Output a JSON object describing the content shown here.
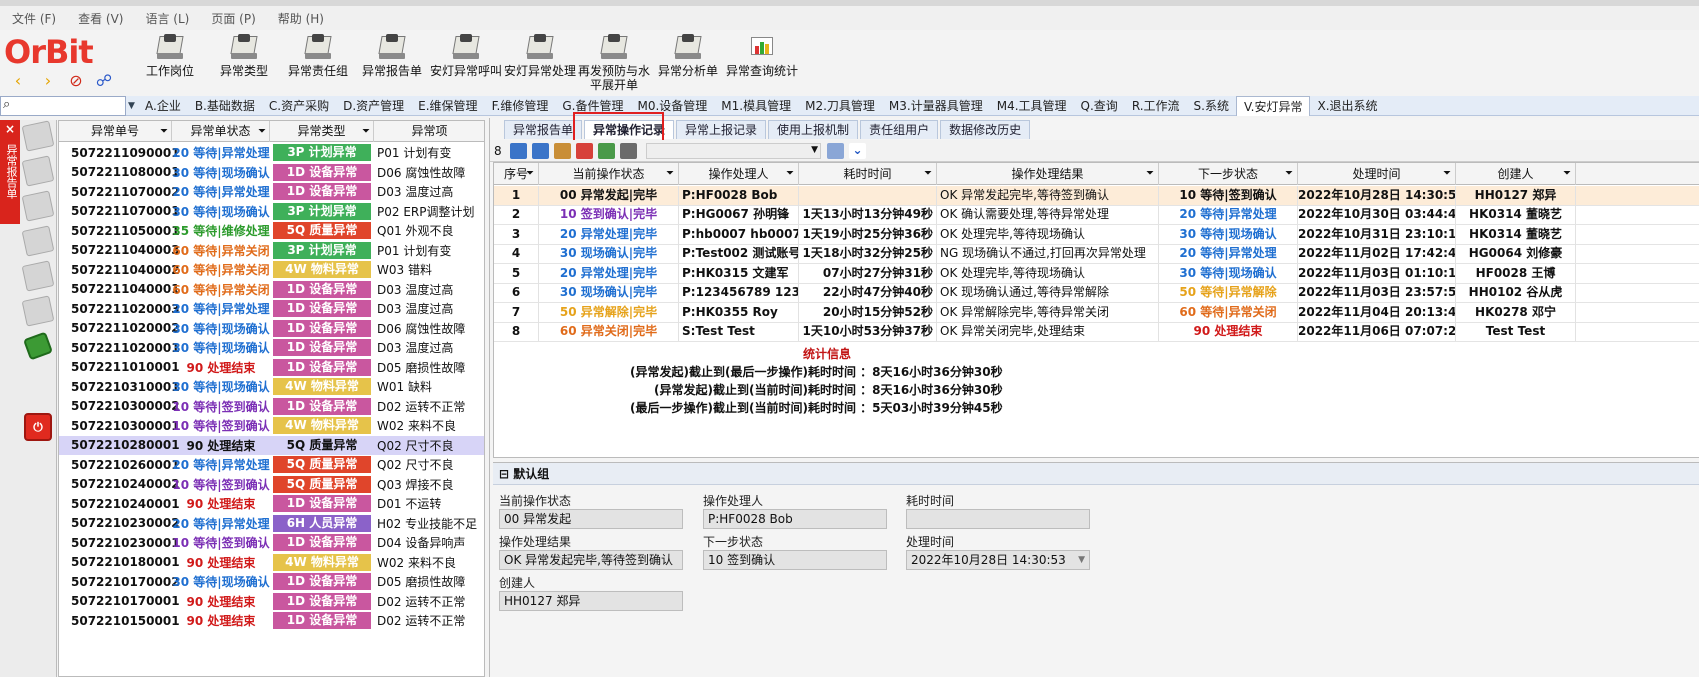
{
  "menu": [
    "文件 (F)",
    "查看 (V)",
    "语言 (L)",
    "页面 (P)",
    "帮助 (H)"
  ],
  "logo": {
    "text": "OrBit"
  },
  "toolbar": [
    "工作岗位",
    "异常类型",
    "异常责任组",
    "异常报告单",
    "安灯异常呼叫",
    "安灯异常处理",
    "再发预防与水平展开单",
    "异常分析单",
    "异常查询统计"
  ],
  "modules": [
    "A.企业",
    "B.基础数据",
    "C.资产采购",
    "D.资产管理",
    "E.维保管理",
    "F.维修管理",
    "G.备件管理",
    "M0.设备管理",
    "M1.模具管理",
    "M2.刀具管理",
    "M3.计量器具管理",
    "M4.工具管理",
    "Q.查询",
    "R.工作流",
    "S.系统",
    "V.安灯异常",
    "X.退出系统"
  ],
  "side_tab": {
    "close": "×",
    "label": "异常报告单"
  },
  "left_list": {
    "headers": [
      "异常单号",
      "异常单状态",
      "异常类型",
      "异常项"
    ],
    "rows": [
      {
        "id": "5072211090001",
        "status": "20 等待|异常处理",
        "sc": "#1f6fd1",
        "type": "3P 计划异常",
        "tc": "#3fb05a",
        "item": "P01 计划有变"
      },
      {
        "id": "5072211080001",
        "status": "30 等待|现场确认",
        "sc": "#1f6fd1",
        "type": "1D 设备异常",
        "tc": "#c9579f",
        "item": "D06 腐蚀性故障"
      },
      {
        "id": "5072211070002",
        "status": "20 等待|异常处理",
        "sc": "#1f6fd1",
        "type": "1D 设备异常",
        "tc": "#c9579f",
        "item": "D03 温度过高"
      },
      {
        "id": "5072211070001",
        "status": "30 等待|现场确认",
        "sc": "#1f6fd1",
        "type": "3P 计划异常",
        "tc": "#3fb05a",
        "item": "P02 ERP调整计划"
      },
      {
        "id": "5072211050001",
        "status": "35 等待|维修处理",
        "sc": "#2c9b2c",
        "type": "5Q 质量异常",
        "tc": "#e0452b",
        "item": "Q01 外观不良"
      },
      {
        "id": "5072211040003",
        "status": "60 等待|异常关闭",
        "sc": "#e06b1a",
        "type": "3P 计划异常",
        "tc": "#3fb05a",
        "item": "P01 计划有变"
      },
      {
        "id": "5072211040002",
        "status": "60 等待|异常关闭",
        "sc": "#e06b1a",
        "type": "4W 物料异常",
        "tc": "#e6c34a",
        "item": "W03 错料"
      },
      {
        "id": "5072211040001",
        "status": "60 等待|异常关闭",
        "sc": "#e06b1a",
        "type": "1D 设备异常",
        "tc": "#c9579f",
        "item": "D03 温度过高"
      },
      {
        "id": "5072211020003",
        "status": "20 等待|异常处理",
        "sc": "#1f6fd1",
        "type": "1D 设备异常",
        "tc": "#c9579f",
        "item": "D03 温度过高"
      },
      {
        "id": "5072211020002",
        "status": "30 等待|现场确认",
        "sc": "#1f6fd1",
        "type": "1D 设备异常",
        "tc": "#c9579f",
        "item": "D06 腐蚀性故障"
      },
      {
        "id": "5072211020001",
        "status": "30 等待|现场确认",
        "sc": "#1f6fd1",
        "type": "1D 设备异常",
        "tc": "#c9579f",
        "item": "D03 温度过高"
      },
      {
        "id": "5072211010001",
        "status": "90 处理结束",
        "sc": "#d11a1a",
        "type": "1D 设备异常",
        "tc": "#c9579f",
        "item": "D05 磨损性故障"
      },
      {
        "id": "5072210310001",
        "status": "30 等待|现场确认",
        "sc": "#1f6fd1",
        "type": "4W 物料异常",
        "tc": "#e6c34a",
        "item": "W01 缺料"
      },
      {
        "id": "5072210300002",
        "status": "10 等待|签到确认",
        "sc": "#7b2fb5",
        "type": "1D 设备异常",
        "tc": "#c9579f",
        "item": "D02 运转不正常"
      },
      {
        "id": "5072210300001",
        "status": "10 等待|签到确认",
        "sc": "#7b2fb5",
        "type": "4W 物料异常",
        "tc": "#e6c34a",
        "item": "W02 来料不良"
      },
      {
        "id": "5072210280001",
        "status": "90 处理结束",
        "sc": "#111111",
        "type": "5Q 质量异常",
        "tc": "",
        "item": "Q02 尺寸不良",
        "sel": true
      },
      {
        "id": "5072210260001",
        "status": "20 等待|异常处理",
        "sc": "#1f6fd1",
        "type": "5Q 质量异常",
        "tc": "#e0452b",
        "item": "Q02 尺寸不良"
      },
      {
        "id": "5072210240002",
        "status": "10 等待|签到确认",
        "sc": "#7b2fb5",
        "type": "5Q 质量异常",
        "tc": "#e0452b",
        "item": "Q03 焊接不良"
      },
      {
        "id": "5072210240001",
        "status": "90 处理结束",
        "sc": "#d11a1a",
        "type": "1D 设备异常",
        "tc": "#c9579f",
        "item": "D01 不运转"
      },
      {
        "id": "5072210230002",
        "status": "20 等待|异常处理",
        "sc": "#1f6fd1",
        "type": "6H 人员异常",
        "tc": "#8b62c9",
        "item": "H02 专业技能不足"
      },
      {
        "id": "5072210230001",
        "status": "10 等待|签到确认",
        "sc": "#7b2fb5",
        "type": "1D 设备异常",
        "tc": "#c9579f",
        "item": "D04 设备异响声"
      },
      {
        "id": "5072210180001",
        "status": "90 处理结束",
        "sc": "#d11a1a",
        "type": "4W 物料异常",
        "tc": "#e6c34a",
        "item": "W02 来料不良"
      },
      {
        "id": "5072210170002",
        "status": "30 等待|现场确认",
        "sc": "#1f6fd1",
        "type": "1D 设备异常",
        "tc": "#c9579f",
        "item": "D05 磨损性故障"
      },
      {
        "id": "5072210170001",
        "status": "90 处理结束",
        "sc": "#d11a1a",
        "type": "1D 设备异常",
        "tc": "#c9579f",
        "item": "D02 运转不正常"
      },
      {
        "id": "5072210150001",
        "status": "90 处理结束",
        "sc": "#d11a1a",
        "type": "1D 设备异常",
        "tc": "#c9579f",
        "item": "D02 运转不正常"
      }
    ]
  },
  "sub_tabs": [
    "异常报告单",
    "异常操作记录",
    "异常上报记录",
    "使用上报机制",
    "责任组用户",
    "数据修改历史"
  ],
  "record_count": "8",
  "grid": {
    "headers": [
      "序号",
      "当前操作状态",
      "操作处理人",
      "耗时时间",
      "操作处理结果",
      "下一步状态",
      "处理时间",
      "创建人"
    ],
    "rows": [
      {
        "no": "1",
        "cur": "00 异常发起|完毕",
        "cc": "#111111",
        "op": "P:HF0028 Bob",
        "dur": "",
        "res": "OK 异常发起完毕,等待签到确认",
        "next": "10 等待|签到确认",
        "nc": "#111111",
        "time": "2022年10月28日  14:30:53",
        "creator": "HH0127 郑异"
      },
      {
        "no": "2",
        "cur": "10 签到确认|完毕",
        "cc": "#7b2fb5",
        "op": "P:HG0067 孙明锋",
        "dur": "1天13小时13分钟49秒",
        "res": "OK 确认需要处理,等待异常处理",
        "next": "20 等待|异常处理",
        "nc": "#1f6fd1",
        "time": "2022年10月30日  03:44:42",
        "creator": "HK0314 董晓艺"
      },
      {
        "no": "3",
        "cur": "20 异常处理|完毕",
        "cc": "#1f6fd1",
        "op": "P:hb0007 hb0007",
        "dur": "1天19小时25分钟36秒",
        "res": "OK 处理完毕,等待现场确认",
        "next": "30 等待|现场确认",
        "nc": "#1f6fd1",
        "time": "2022年10月31日  23:10:18",
        "creator": "HK0314 董晓艺"
      },
      {
        "no": "4",
        "cur": "30 现场确认|完毕",
        "cc": "#1f6fd1",
        "op": "P:Test002 测试账号",
        "dur": "1天18小时32分钟25秒",
        "res": "NG 现场确认不通过,打回再次异常处理",
        "next": "20 等待|异常处理",
        "nc": "#1f6fd1",
        "time": "2022年11月02日  17:42:43",
        "creator": "HG0064 刘修豪"
      },
      {
        "no": "5",
        "cur": "20 异常处理|完毕",
        "cc": "#1f6fd1",
        "op": "P:HK0315 文建军",
        "dur": "07小时27分钟31秒",
        "res": "OK 处理完毕,等待现场确认",
        "next": "30 等待|现场确认",
        "nc": "#1f6fd1",
        "time": "2022年11月03日  01:10:14",
        "creator": "HF0028 王博"
      },
      {
        "no": "6",
        "cur": "30 现场确认|完毕",
        "cc": "#1f6fd1",
        "op": "P:123456789  123...",
        "dur": "22小时47分钟40秒",
        "res": "OK 现场确认通过,等待异常解除",
        "next": "50 等待|异常解除",
        "nc": "#e6a21a",
        "time": "2022年11月03日  23:57:54",
        "creator": "HH0102 谷从虎"
      },
      {
        "no": "7",
        "cur": "50 异常解除|完毕",
        "cc": "#e6a21a",
        "op": "P:HK0355 Roy",
        "dur": "20小时15分钟52秒",
        "res": "OK 异常解除完毕,等待异常关闭",
        "next": "60 等待|异常关闭",
        "nc": "#e06b1a",
        "time": "2022年11月04日  20:13:46",
        "creator": "HK0278 邓宁"
      },
      {
        "no": "8",
        "cur": "60 异常关闭|完毕",
        "cc": "#e06b1a",
        "op": "S:Test Test",
        "dur": "1天10小时53分钟37秒",
        "res": "OK 异常关闭完毕,处理结束",
        "next": "90 处理结束",
        "nc": "#d11a1a",
        "time": "2022年11月06日  07:07:23",
        "creator": "Test Test"
      }
    ]
  },
  "stats": {
    "title": "统计信息",
    "lines": [
      "(异常发起)截止到(最后一步操作)耗时时间 ：8天16小时36分钟30秒",
      "(异常发起)截止到(当前时间)耗时时间 ：8天16小时36分钟30秒",
      "(最后一步操作)截止到(当前时间)耗时时间 ：5天03小时39分钟45秒"
    ]
  },
  "group": {
    "title": "默认组",
    "collapse": "⊟",
    "fields": {
      "cur_label": "当前操作状态",
      "cur_value": "00 异常发起",
      "op_label": "操作处理人",
      "op_value": "P:HF0028 Bob",
      "dur_label": "耗时时间",
      "dur_value": "",
      "res_label": "操作处理结果",
      "res_value": "OK 异常发起完毕,等待签到确认",
      "next_label": "下一步状态",
      "next_value": "10 签到确认",
      "time_label": "处理时间",
      "time_value": "2022年10月28日 14:30:53",
      "creator_label": "创建人",
      "creator_value": "HH0127 郑异"
    }
  }
}
